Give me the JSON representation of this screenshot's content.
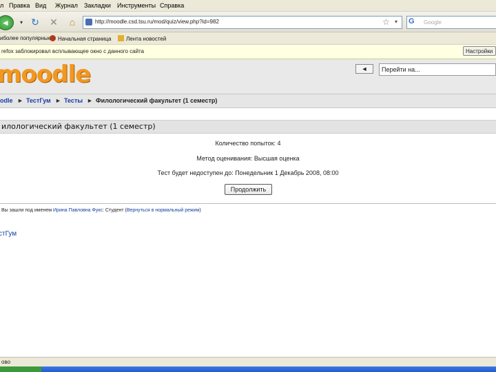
{
  "menu": [
    "л",
    "Правка",
    "Вид",
    "Журнал",
    "Закладки",
    "Инструменты",
    "Справка"
  ],
  "nav": {
    "url": "http://moodle.csd.tsu.ru/mod/quiz/view.php?id=982",
    "search_placeholder": "Google"
  },
  "bookmarks": [
    "иболее популярные",
    "Начальная страница",
    "Лента новостей"
  ],
  "infobar": {
    "message": "refox заблокировал всплывающее окно с данного сайта",
    "button": "Настройки"
  },
  "header": {
    "logo": "moodle",
    "jump_button": "◄",
    "jump_select": "Перейти на..."
  },
  "breadcrumb": [
    "odle",
    "ТестГум",
    "Тесты",
    "Филологический факультет (1 семестр)"
  ],
  "page": {
    "heading": "илологический факультет (1 семестр)",
    "attempts": "Количество попыток: 4",
    "grading": "Метод оценивания: Высшая оценка",
    "deadline": "Тест будет недоступен до: Понедельник 1 Декабрь 2008, 08:00",
    "continue_button": "Продолжить"
  },
  "footer": {
    "login_prefix": "Вы зашли под именем",
    "user_name": "Ирина Павловна Фукс",
    "login_mid": ": Студент (",
    "return_link": "Вернуться в нормальный режим",
    "login_suffix": ")",
    "course_link": "стГум"
  },
  "status": "ово",
  "colors": {
    "logo_orange": "#f2981f",
    "link_blue": "#1440a0",
    "infobar_yellow": "#ffffe1",
    "chrome_beige": "#ece9d8"
  }
}
